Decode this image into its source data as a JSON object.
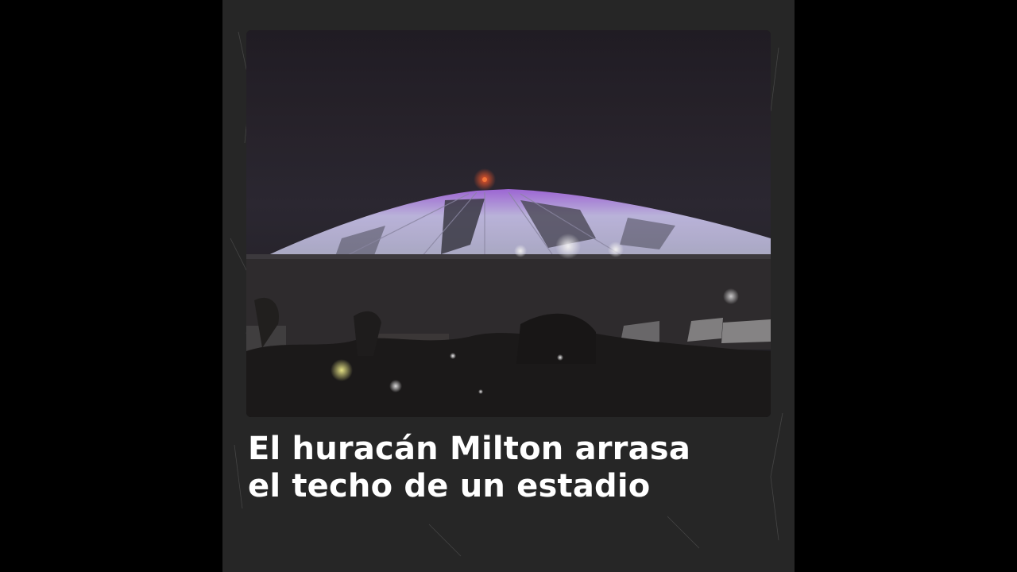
{
  "headline": {
    "line1": "El huracán Milton arrasa",
    "line2": "el techo de un estadio"
  },
  "colors": {
    "page_background": "#000000",
    "card_background": "#262626",
    "headline_text": "#ffffff",
    "dome_light": "#c9bfe8",
    "dome_glow": "#9a55d8"
  },
  "image": {
    "subject": "stadium-dome-at-night"
  }
}
